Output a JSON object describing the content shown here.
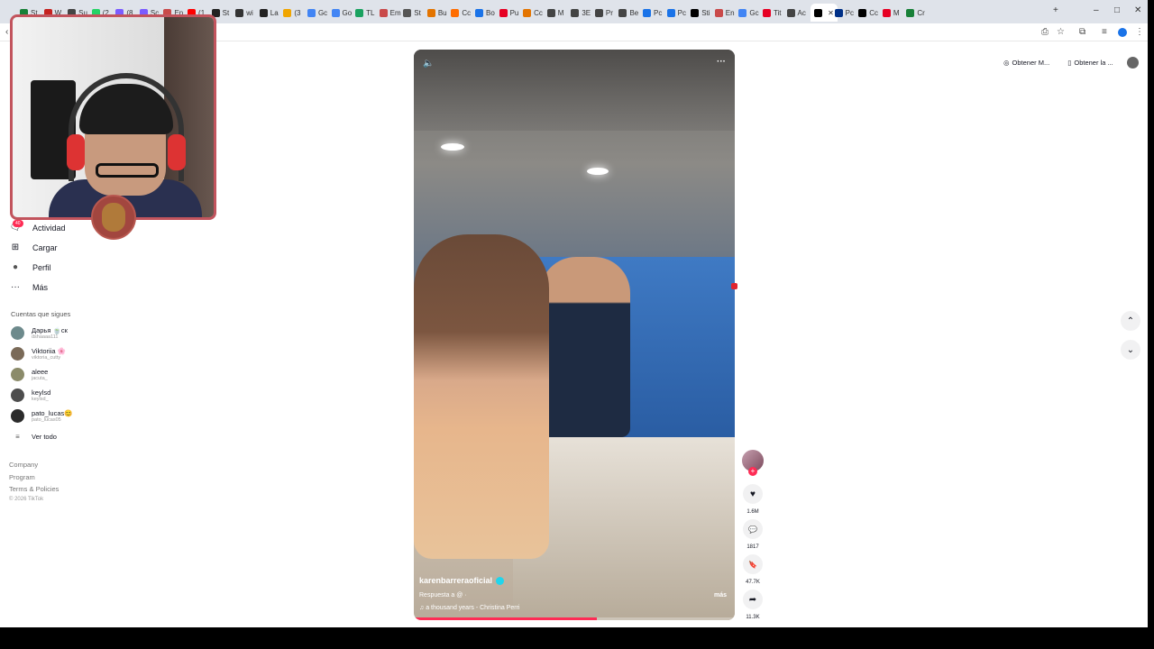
{
  "browser": {
    "tabs": [
      {
        "label": "St",
        "color": "#188038"
      },
      {
        "label": "W",
        "color": "#c5221f"
      },
      {
        "label": "Su",
        "color": "#444444"
      },
      {
        "label": "(2",
        "color": "#25d366"
      },
      {
        "label": "(8",
        "color": "#7b5cff"
      },
      {
        "label": "Sc",
        "color": "#7b5cff"
      },
      {
        "label": "En",
        "color": "#c94a4a"
      },
      {
        "label": "(1",
        "color": "#ff0000"
      },
      {
        "label": "St",
        "color": "#222222"
      },
      {
        "label": "wi",
        "color": "#333333"
      },
      {
        "label": "La",
        "color": "#222222"
      },
      {
        "label": "(3",
        "color": "#f0a500"
      },
      {
        "label": "Gc",
        "color": "#4285f4"
      },
      {
        "label": "Go",
        "color": "#4285f4"
      },
      {
        "label": "TL",
        "color": "#1aa260"
      },
      {
        "label": "Em",
        "color": "#c94a4a"
      },
      {
        "label": "St",
        "color": "#555555"
      },
      {
        "label": "Bu",
        "color": "#e37400"
      },
      {
        "label": "Cc",
        "color": "#ff6d00"
      },
      {
        "label": "Bo",
        "color": "#1a73e8"
      },
      {
        "label": "Pu",
        "color": "#e60023"
      },
      {
        "label": "Cc",
        "color": "#e37400"
      },
      {
        "label": "M",
        "color": "#444444"
      },
      {
        "label": "3E",
        "color": "#444444"
      },
      {
        "label": "Pr",
        "color": "#444444"
      },
      {
        "label": "Be",
        "color": "#444444"
      },
      {
        "label": "Pc",
        "color": "#1a73e8"
      },
      {
        "label": "Pc",
        "color": "#1a73e8"
      },
      {
        "label": "Sti",
        "color": "#000000"
      },
      {
        "label": "En",
        "color": "#c94a4a"
      },
      {
        "label": "Gc",
        "color": "#4285f4"
      },
      {
        "label": "Tit",
        "color": "#e60023"
      },
      {
        "label": "Ac",
        "color": "#444444"
      },
      {
        "label": "",
        "color": "#000000",
        "active": true
      },
      {
        "label": "Pc",
        "color": "#003087"
      },
      {
        "label": "Cc",
        "color": "#000000"
      },
      {
        "label": "M",
        "color": "#e60023"
      },
      {
        "label": "Cr",
        "color": "#188038"
      }
    ],
    "new_tab": "+",
    "window_controls": {
      "minimize": "–",
      "maximize": "□",
      "close": "✕"
    },
    "toolbar_icons": [
      "back-icon",
      "install-icon",
      "bookmark-icon",
      "extensions-icon",
      "media-icon",
      "profile-icon",
      "menu-icon"
    ]
  },
  "sidebar": {
    "items": [
      {
        "label": "Actividad",
        "icon": "activity-icon",
        "glyph": "🗨",
        "badge": "40"
      },
      {
        "label": "Cargar",
        "icon": "upload-icon",
        "glyph": "⊞"
      },
      {
        "label": "Perfil",
        "icon": "profile-icon",
        "glyph": "●"
      },
      {
        "label": "Más",
        "icon": "more-icon",
        "glyph": "···"
      }
    ],
    "following_title": "Cuentas que sigues",
    "following": [
      {
        "name": "Дарья 🍵ск",
        "handle": "dshaaaa111"
      },
      {
        "name": "Viktoriia 🌸",
        "handle": "viktoria_cutty"
      },
      {
        "name": "aleee",
        "handle": "jacuta_"
      },
      {
        "name": "keylsd",
        "handle": "keylsd_"
      },
      {
        "name": "pato_lucas😊",
        "handle": "pato_lucas05"
      }
    ],
    "see_all": "Ver todo",
    "footer": [
      "Company",
      "Program",
      "Terms & Policies",
      "© 2026 TikTok"
    ]
  },
  "video": {
    "username": "karenbarreraoficial",
    "caption": "Respuesta a @ ·",
    "more": "más",
    "music": "♫  a thousand years - Christina Perri",
    "progress": 0.57
  },
  "actions": [
    {
      "name": "like",
      "glyph": "♥",
      "count": "1.6M"
    },
    {
      "name": "comment",
      "glyph": "💬",
      "count": "1817"
    },
    {
      "name": "save",
      "glyph": "🔖",
      "count": "47.7K"
    },
    {
      "name": "share",
      "glyph": "➦",
      "count": "11.3K"
    }
  ],
  "top_right": {
    "get_button": "Obtener M...",
    "app_button": "Obtener la ..."
  },
  "colors": {
    "accent": "#fe2c55",
    "webcam_border": "#c2545d"
  }
}
